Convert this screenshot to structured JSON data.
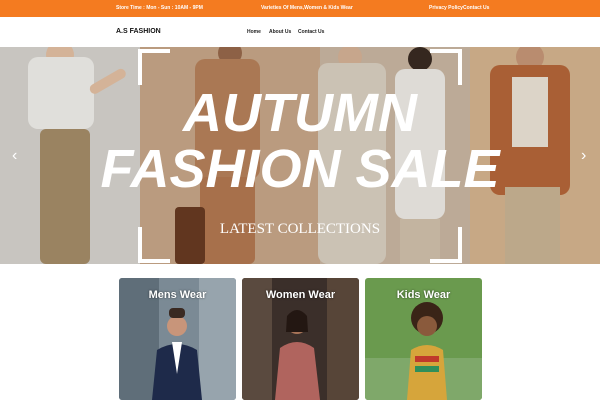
{
  "topbar": {
    "store_time": "Store Time : Mon - Sun : 10AM - 9PM",
    "tagline": "Varieties Of Mens,Women & Kids Wear",
    "privacy": "Privacy Policy",
    "contact": "Contact Us",
    "bg_color": "#f47b20"
  },
  "navbar": {
    "brand": "A.S FASHION",
    "links": [
      "Home",
      "About Us",
      "Contact Us"
    ]
  },
  "hero": {
    "headline_line1": "AUTUMN",
    "headline_line2": "FASHION SALE",
    "subheadline": "LATEST COLLECTIONS",
    "prev_icon": "chevron-left-icon",
    "next_icon": "chevron-right-icon",
    "prev_glyph": "‹",
    "next_glyph": "›"
  },
  "categories": [
    {
      "title": "Mens Wear"
    },
    {
      "title": "Women Wear"
    },
    {
      "title": "Kids Wear"
    }
  ]
}
